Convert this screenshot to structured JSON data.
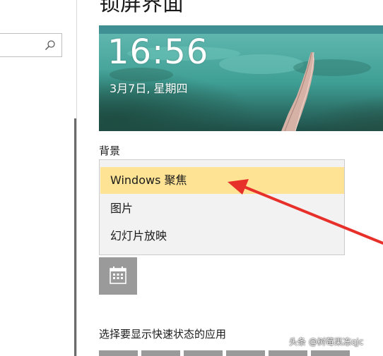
{
  "page": {
    "title": "锁屏界面"
  },
  "preview": {
    "time": "16:56",
    "date": "3月7日, 星期四"
  },
  "background": {
    "label": "背景",
    "options": [
      {
        "label": "Windows 聚焦",
        "selected": true
      },
      {
        "label": "图片",
        "selected": false
      },
      {
        "label": "幻灯片放映",
        "selected": false
      }
    ],
    "selected_highlight_color": "#ffe395"
  },
  "quick_status": {
    "heading": "选择要显示快速状态的应用"
  },
  "icons": {
    "search": "search-icon",
    "calendar": "calendar-icon"
  },
  "annotation": {
    "arrow_color": "#e8302a"
  },
  "watermark": {
    "text": "头条 @树莓果冻qjc"
  }
}
